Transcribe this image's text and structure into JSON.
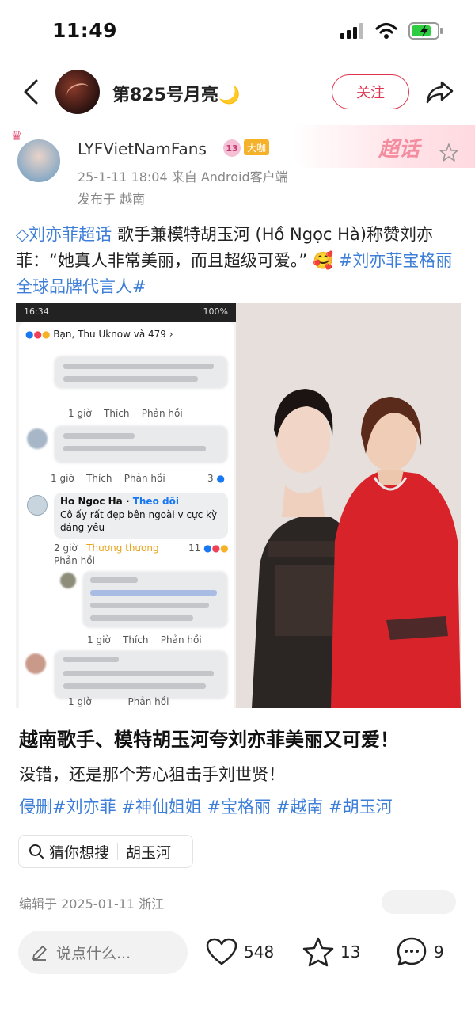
{
  "status_bar": {
    "time": "11:49"
  },
  "nav": {
    "title": "第825号月亮",
    "moon": "🌙",
    "follow_label": "关注"
  },
  "author": {
    "name": "LYFVietNamFans",
    "level_badge": "13",
    "big_badge": "大咖",
    "meta": "25-1-11 18:04  来自 Android客户端",
    "location": "发布于 越南",
    "chaohua_label": "超话"
  },
  "post": {
    "topic": "刘亦菲超话",
    "text_main": "歌手兼模特胡玉河 (Hồ Ngọc Hà)称赞刘亦菲：“她真人非常美丽，而且超级可爱。”",
    "emoji": "🥰",
    "hashtag": "#刘亦菲宝格丽全球品牌代言人#"
  },
  "screenshot": {
    "phone_time": "16:34",
    "phone_battery": "100%",
    "reactions": "Bạn, Thu Uknow và 479",
    "c1_actions": [
      "1 giờ",
      "Thích",
      "Phản hồi"
    ],
    "c2_actions": [
      "1 giờ",
      "Thích",
      "Phản hồi"
    ],
    "c2_count": "3",
    "hn_name": "Ho Ngoc Ha",
    "hn_follow": "Theo dõi",
    "hn_text": "Cô ấy rất đẹp bên ngoài v cực kỳ đáng yêu",
    "hn_time": "2 giờ",
    "hn_reaction_label": "Thương thương",
    "hn_count": "11",
    "hn_reply": "Phản hồi",
    "c3_actions": [
      "1 giờ",
      "Thích",
      "Phản hồi"
    ],
    "c4_time": "1 giờ",
    "c4_reply": "Phản hồi"
  },
  "content": {
    "title": "越南歌手、模特胡玉河夸刘亦菲美丽又可爱！",
    "line2": "没错，还是那个芳心狙击手刘世贤！",
    "line3": "侵删#刘亦菲 #神仙姐姐 #宝格丽 #越南 #胡玉河"
  },
  "search_chip": {
    "label": "猜你想搜",
    "keyword": "胡玉河"
  },
  "edit_info": "编辑于 2025-01-11 浙江",
  "bottom": {
    "comment_placeholder": "说点什么...",
    "likes": "548",
    "stars": "13",
    "comments": "9"
  },
  "colors": {
    "accent_red": "#e0334f",
    "link_blue": "#3d7ed8"
  }
}
